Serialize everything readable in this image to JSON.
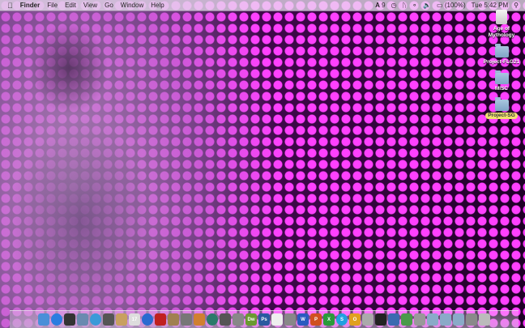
{
  "menubar": {
    "app": "Finder",
    "items": [
      "File",
      "Edit",
      "View",
      "Go",
      "Window",
      "Help"
    ],
    "status": {
      "adobe": "9",
      "battery": "(100%)",
      "clock": "Tue 5:42 PM"
    }
  },
  "desktop_icons": [
    {
      "label": "Age of Mythology",
      "type": "drive",
      "selected": false
    },
    {
      "label": "Project-FLG21",
      "type": "folder",
      "selected": false
    },
    {
      "label": "MISC",
      "type": "folder",
      "selected": false
    },
    {
      "label": "Project-SG",
      "type": "folder",
      "selected": true
    }
  ],
  "dock": [
    {
      "name": "finder",
      "color": "#4a8fd8"
    },
    {
      "name": "app-store",
      "color": "#2a7de0"
    },
    {
      "name": "dashboard",
      "color": "#333"
    },
    {
      "name": "preview",
      "color": "#6a8ab0"
    },
    {
      "name": "safari",
      "color": "#3a9ad8"
    },
    {
      "name": "facetime",
      "color": "#555"
    },
    {
      "name": "address-book",
      "color": "#c8a060"
    },
    {
      "name": "ical",
      "color": "#ddd",
      "text": "17"
    },
    {
      "name": "itunes",
      "color": "#2a6ad0"
    },
    {
      "name": "photo-booth",
      "color": "#c02020"
    },
    {
      "name": "iphoto",
      "color": "#a08050"
    },
    {
      "name": "sparkle",
      "color": "#777"
    },
    {
      "name": "garageband",
      "color": "#d08030"
    },
    {
      "name": "time-machine",
      "color": "#2a7a6a"
    },
    {
      "name": "dvd-player",
      "color": "#555"
    },
    {
      "name": "system-preferences",
      "color": "#888"
    },
    {
      "name": "dreamweaver",
      "color": "#6a9a30",
      "text": "Dw"
    },
    {
      "name": "photoshop",
      "color": "#2a5aa0",
      "text": "Ps"
    },
    {
      "name": "acrobat",
      "color": "#eee"
    },
    {
      "name": "image-capture",
      "color": "#888"
    },
    {
      "name": "word",
      "color": "#2a5ac0",
      "text": "W"
    },
    {
      "name": "powerpoint",
      "color": "#d05020",
      "text": "P"
    },
    {
      "name": "excel",
      "color": "#2a9a3a",
      "text": "X"
    },
    {
      "name": "skype",
      "color": "#20a0e0",
      "text": "S"
    },
    {
      "name": "outlook",
      "color": "#e0a020",
      "text": "O"
    },
    {
      "name": "disk-utility",
      "color": "#aaa"
    },
    {
      "name": "terminal",
      "color": "#222"
    },
    {
      "name": "xcode",
      "color": "#3a6ab0"
    },
    {
      "name": "network-utility",
      "color": "#4a9a4a"
    },
    {
      "name": "camera",
      "color": "#999"
    },
    {
      "name": "applications-folder",
      "color": "#8aaac8"
    },
    {
      "name": "documents-folder",
      "color": "#8aaac8"
    },
    {
      "name": "downloads-folder",
      "color": "#8aaac8"
    },
    {
      "name": "stack",
      "color": "#8a8a8a"
    },
    {
      "name": "trash",
      "color": "#bbb"
    }
  ]
}
